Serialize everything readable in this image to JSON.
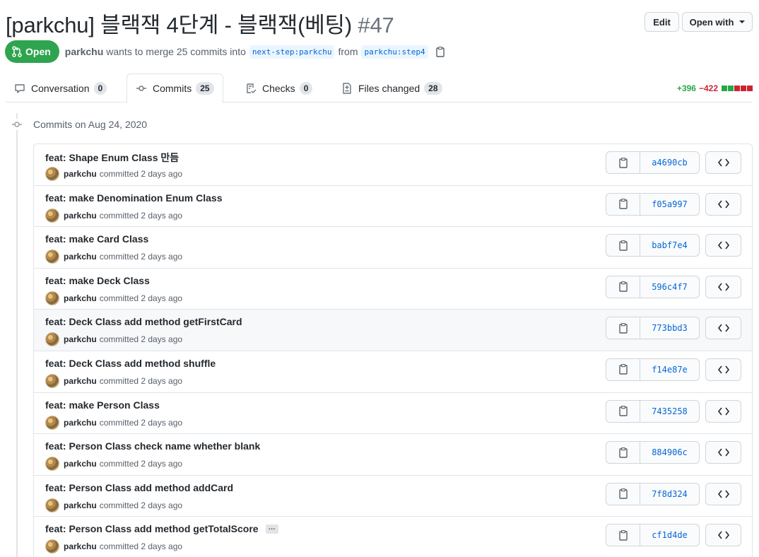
{
  "header": {
    "title": "[parkchu] 블랙잭 4단계 - 블랙잭(베팅)",
    "number": "#47",
    "edit_label": "Edit",
    "open_with_label": "Open with"
  },
  "meta": {
    "state": "Open",
    "author": "parkchu",
    "text_merge": "wants to merge 25 commits into",
    "base_branch": "next-step:parkchu",
    "text_from": "from",
    "head_branch": "parkchu:step4"
  },
  "tabs": [
    {
      "label": "Conversation",
      "count": "0",
      "icon": "comment-icon"
    },
    {
      "label": "Commits",
      "count": "25",
      "icon": "commit-icon"
    },
    {
      "label": "Checks",
      "count": "0",
      "icon": "checklist-icon"
    },
    {
      "label": "Files changed",
      "count": "28",
      "icon": "file-diff-icon"
    }
  ],
  "diffstat": {
    "additions": "+396",
    "deletions": "−422",
    "colors": [
      "#28a745",
      "#28a745",
      "#cb2431",
      "#cb2431",
      "#cb2431"
    ]
  },
  "commits_date": "Commits on Aug 24, 2020",
  "commits": [
    {
      "message": "feat: Shape Enum Class 만듬",
      "author": "parkchu",
      "time": "committed 2 days ago",
      "sha": "a4690cb"
    },
    {
      "message": "feat: make Denomination Enum Class",
      "author": "parkchu",
      "time": "committed 2 days ago",
      "sha": "f05a997"
    },
    {
      "message": "feat: make Card Class",
      "author": "parkchu",
      "time": "committed 2 days ago",
      "sha": "babf7e4"
    },
    {
      "message": "feat: make Deck Class",
      "author": "parkchu",
      "time": "committed 2 days ago",
      "sha": "596c4f7"
    },
    {
      "message": "feat: Deck Class add method getFirstCard",
      "author": "parkchu",
      "time": "committed 2 days ago",
      "sha": "773bbd3"
    },
    {
      "message": "feat: Deck Class add method shuffle",
      "author": "parkchu",
      "time": "committed 2 days ago",
      "sha": "f14e87e"
    },
    {
      "message": "feat: make Person Class",
      "author": "parkchu",
      "time": "committed 2 days ago",
      "sha": "7435258"
    },
    {
      "message": "feat: Person Class check name whether blank",
      "author": "parkchu",
      "time": "committed 2 days ago",
      "sha": "884906c"
    },
    {
      "message": "feat: Person Class add method addCard",
      "author": "parkchu",
      "time": "committed 2 days ago",
      "sha": "7f8d324"
    },
    {
      "message": "feat: Person Class add method getTotalScore",
      "author": "parkchu",
      "time": "committed 2 days ago",
      "sha": "cf1d4de",
      "ellipsis": "…"
    }
  ]
}
